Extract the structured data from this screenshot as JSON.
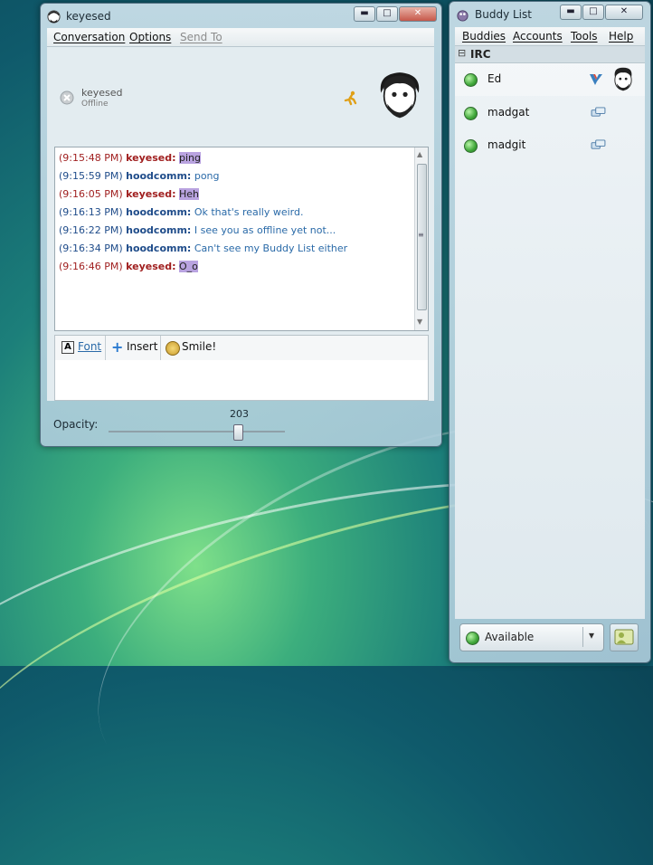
{
  "conversation_window": {
    "title": "keyesed",
    "title_buttons": {
      "minimize": "▬",
      "maximize": "□",
      "close": "✕"
    },
    "menu": [
      "Conversation",
      "Options",
      "Send To"
    ],
    "contact": {
      "name": "keyesed",
      "status": "Offline"
    },
    "messages": [
      {
        "time": "(9:15:48 PM)",
        "nick": "keyesed:",
        "text": "ping",
        "from": "remote"
      },
      {
        "time": "(9:15:59 PM)",
        "nick": "hoodcomm:",
        "text": "pong",
        "from": "self"
      },
      {
        "time": "(9:16:05 PM)",
        "nick": "keyesed:",
        "text": "Heh",
        "from": "remote"
      },
      {
        "time": "(9:16:13 PM)",
        "nick": "hoodcomm:",
        "text": "Ok that's really weird.",
        "from": "self"
      },
      {
        "time": "(9:16:22 PM)",
        "nick": "hoodcomm:",
        "text": "I see you as offline yet not...",
        "from": "self"
      },
      {
        "time": "(9:16:34 PM)",
        "nick": "hoodcomm:",
        "text": "Can't see my Buddy List either",
        "from": "self"
      },
      {
        "time": "(9:16:46 PM)",
        "nick": "keyesed:",
        "text": "O_o",
        "from": "remote"
      }
    ],
    "toolbar": {
      "font": "Font",
      "insert": "Insert",
      "smile": "Smile!"
    },
    "opacity": {
      "label": "Opacity:",
      "value": "203"
    }
  },
  "buddy_window": {
    "title": "Buddy List",
    "title_buttons": {
      "minimize": "▬",
      "maximize": "□",
      "close": "✕"
    },
    "menu": [
      "Buddies",
      "Accounts",
      "Tools",
      "Help"
    ],
    "group": {
      "name": "IRC",
      "toggle": "⊟"
    },
    "buddies": [
      {
        "name": "Ed",
        "status_color": "#3fa639"
      },
      {
        "name": "madgat",
        "status_color": "#3fa639"
      },
      {
        "name": "madgit",
        "status_color": "#3fa639"
      }
    ],
    "status_selector": {
      "value": "Available",
      "arrow": "▾"
    }
  },
  "colors": {
    "remote": "#a01f1f",
    "self": "#1f4c8a",
    "highlight": "#b9a3e0"
  }
}
